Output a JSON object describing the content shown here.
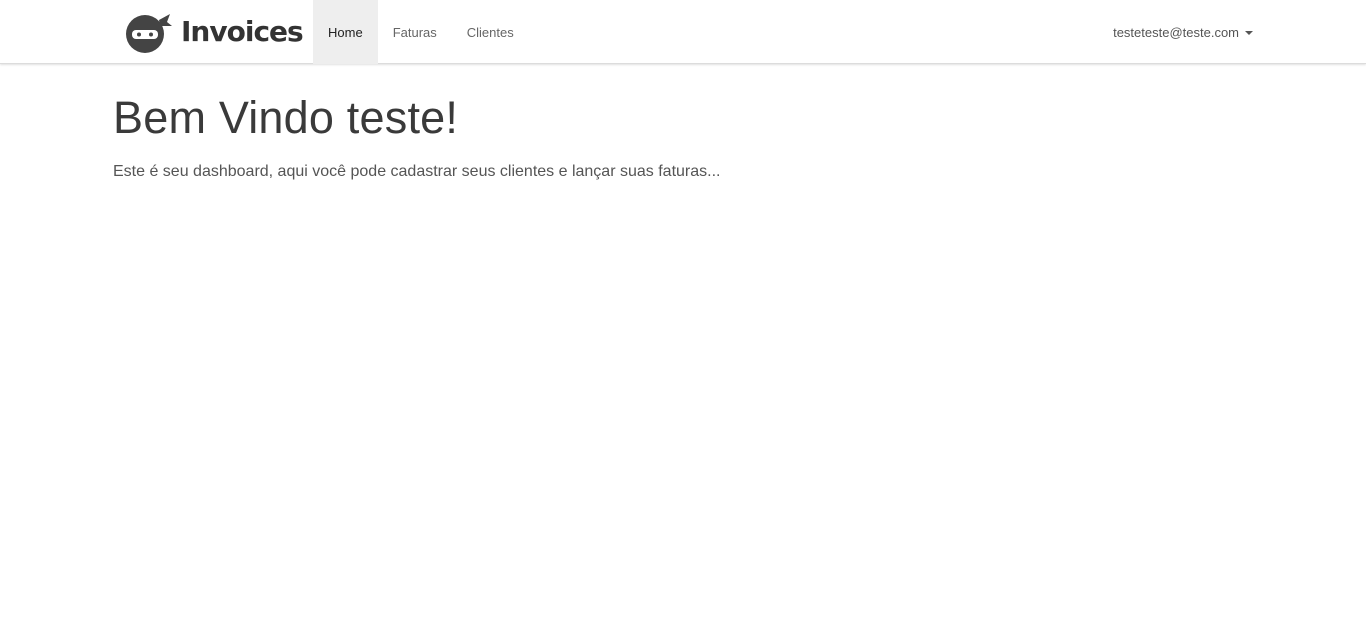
{
  "brand": {
    "name": "Invoices",
    "logo_icon": "ninja-icon"
  },
  "nav": {
    "items": [
      {
        "label": "Home",
        "active": true
      },
      {
        "label": "Faturas",
        "active": false
      },
      {
        "label": "Clientes",
        "active": false
      }
    ]
  },
  "user": {
    "email": "testeteste@teste.com",
    "dropdown_icon": "caret-down-icon"
  },
  "main": {
    "title": "Bem Vindo teste!",
    "lead": "Este é seu dashboard, aqui você pode cadastrar seus clientes e lançar suas faturas..."
  },
  "colors": {
    "active_nav_bg": "#eeeeee",
    "text": "#444444"
  }
}
